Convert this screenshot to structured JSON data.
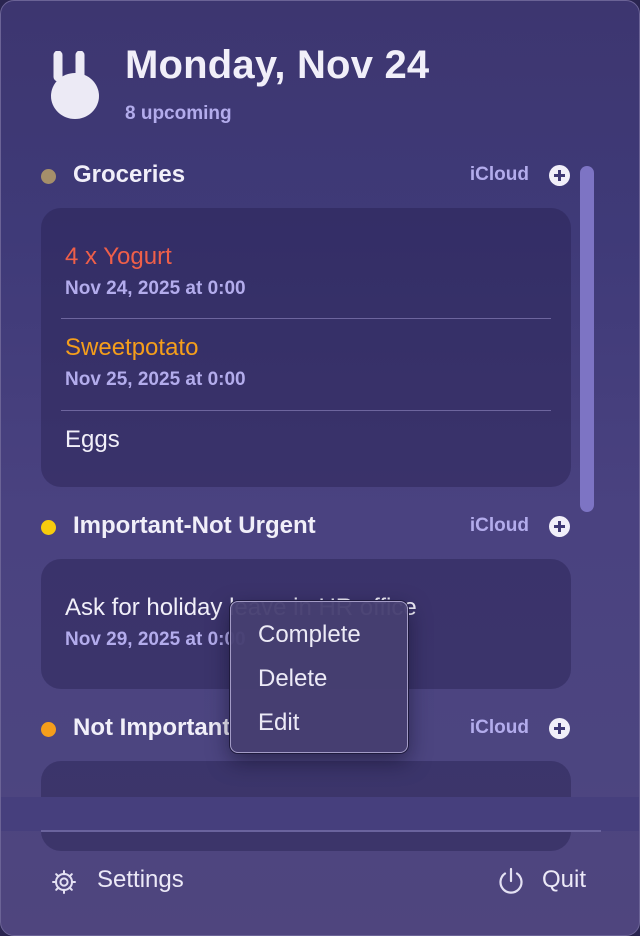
{
  "header": {
    "title": "Monday, Nov 24",
    "subtitle": "8 upcoming",
    "logo_icon": "bunny-logo-icon"
  },
  "lists": [
    {
      "name": "Groceries",
      "account": "iCloud",
      "color": "#a58f6a",
      "add_icon": "plus-circle-icon",
      "items": [
        {
          "title": "4 x Yogurt",
          "date": "Nov 24, 2025 at 0:00",
          "color": "#ef5f49"
        },
        {
          "title": "Sweetpotato",
          "date": "Nov 25, 2025 at 0:00",
          "color": "#f59e1b"
        },
        {
          "title": "Eggs",
          "color": "#f1eff9"
        }
      ]
    },
    {
      "name": "Important-Not Urgent",
      "account": "iCloud",
      "color": "#f7cc0d",
      "add_icon": "plus-circle-icon",
      "items": [
        {
          "title": "Ask for holiday leave in HR office",
          "date": "Nov 29, 2025 at 0:00",
          "color": "#f1eff9"
        }
      ]
    },
    {
      "name": "Not Important",
      "account": "iCloud",
      "color": "#f59e1b",
      "add_icon": "plus-circle-icon",
      "items": []
    }
  ],
  "context_menu": {
    "items": [
      "Complete",
      "Delete",
      "Edit"
    ]
  },
  "footer": {
    "settings_label": "Settings",
    "settings_icon": "gear-icon",
    "quit_label": "Quit",
    "quit_icon": "power-icon"
  }
}
